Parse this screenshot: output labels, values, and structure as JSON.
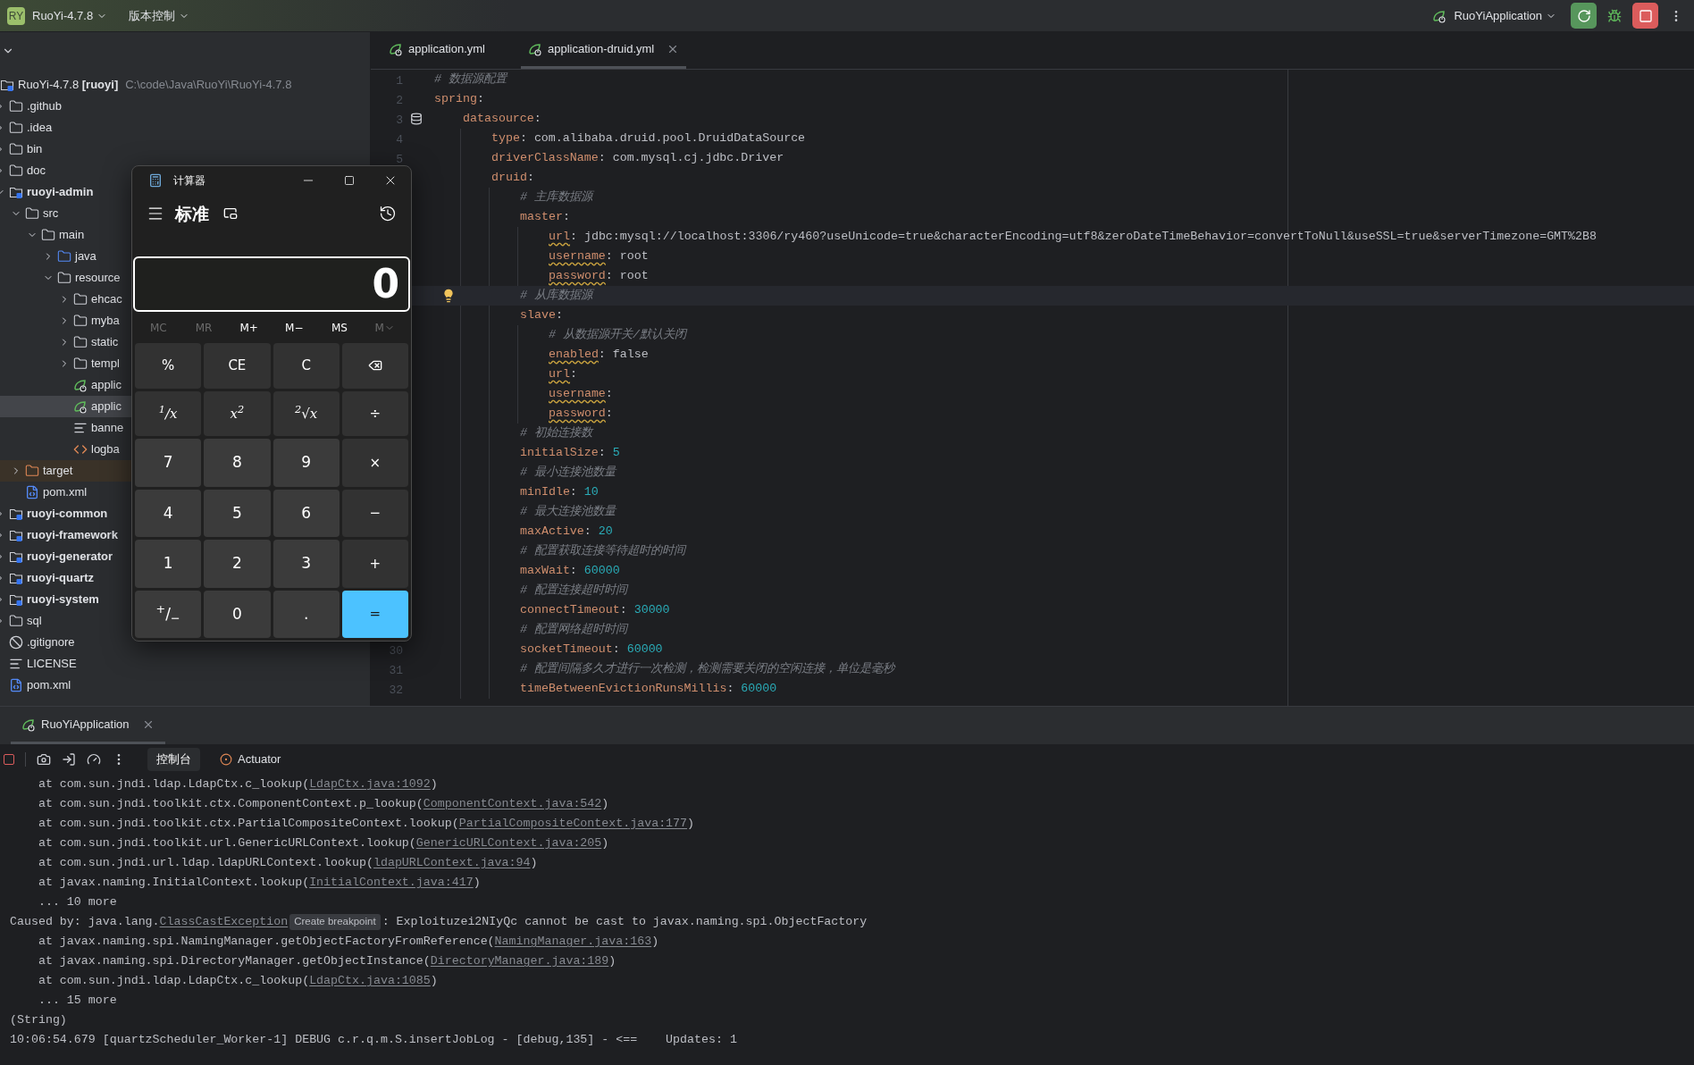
{
  "title_bar": {
    "logo": "RY",
    "project": "RuoYi-4.7.8",
    "vcs": "版本控制",
    "run_config": "RuoYiApplication"
  },
  "project": {
    "tree": [
      {
        "label": "RuoYi-4.7.8 **[ruoyi]**",
        "hint": "C:\\code\\Java\\RuoYi\\RuoYi-4.7.8",
        "kind": "module",
        "selected": false,
        "children": [
          {
            "label": ".github",
            "kind": "folder",
            "expanded": false,
            "selected": false
          },
          {
            "label": ".idea",
            "kind": "folder",
            "expanded": false,
            "selected": false
          },
          {
            "label": "bin",
            "kind": "folder",
            "expanded": false,
            "selected": false
          },
          {
            "label": "doc",
            "kind": "folder",
            "expanded": false,
            "selected": false
          },
          {
            "label": "ruoyi-admin",
            "kind": "module",
            "expanded": true,
            "selected": false,
            "children": [
              {
                "label": "src",
                "kind": "folder",
                "expanded": true,
                "selected": false,
                "children": [
                  {
                    "label": "main",
                    "kind": "folder",
                    "expanded": true,
                    "selected": false,
                    "children": [
                      {
                        "label": "java",
                        "kind": "source-folder",
                        "expanded": false,
                        "selected": false
                      },
                      {
                        "label": "resource",
                        "kind": "resource-folder",
                        "expanded": true,
                        "selected": false,
                        "children": [
                          {
                            "label": "ehcac",
                            "kind": "folder",
                            "expanded": false,
                            "selected": false
                          },
                          {
                            "label": "myba",
                            "kind": "folder",
                            "expanded": false,
                            "selected": false
                          },
                          {
                            "label": "static",
                            "kind": "folder",
                            "expanded": false,
                            "selected": false
                          },
                          {
                            "label": "templ",
                            "kind": "folder",
                            "expanded": false,
                            "selected": false
                          },
                          {
                            "label": "applic",
                            "kind": "yaml",
                            "selected": false
                          },
                          {
                            "label": "applic",
                            "kind": "yaml",
                            "selected": true
                          },
                          {
                            "label": "banne",
                            "kind": "text",
                            "selected": false
                          },
                          {
                            "label": "logba",
                            "kind": "xml",
                            "selected": false
                          }
                        ]
                      }
                    ]
                  }
                ]
              },
              {
                "label": "target",
                "kind": "excluded-folder",
                "expanded": false,
                "selected": false
              },
              {
                "label": "pom.xml",
                "kind": "maven",
                "selected": false
              }
            ]
          },
          {
            "label": "ruoyi-common",
            "kind": "module",
            "expanded": false,
            "selected": false
          },
          {
            "label": "ruoyi-framework",
            "kind": "module",
            "expanded": false,
            "selected": false
          },
          {
            "label": "ruoyi-generator",
            "kind": "module",
            "expanded": false,
            "selected": false
          },
          {
            "label": "ruoyi-quartz",
            "kind": "module",
            "expanded": false,
            "selected": false
          },
          {
            "label": "ruoyi-system",
            "kind": "module",
            "expanded": false,
            "selected": false
          },
          {
            "label": "sql",
            "kind": "folder",
            "expanded": false,
            "selected": false
          },
          {
            "label": ".gitignore",
            "kind": "ignore",
            "selected": false
          },
          {
            "label": "LICENSE",
            "kind": "text",
            "selected": false
          },
          {
            "label": "pom.xml",
            "kind": "maven",
            "selected": false
          }
        ]
      }
    ]
  },
  "editor": {
    "tabs": [
      {
        "label": "application.yml",
        "selected": false
      },
      {
        "label": "application-druid.yml",
        "selected": true
      }
    ],
    "lines": [
      {
        "number": "1",
        "kind": "comment",
        "text": "# 数据源配置",
        "caret": false
      },
      {
        "number": "2",
        "kind": "key",
        "key": "spring:",
        "warning": false,
        "caret": false,
        "children": [
          {
            "number": "3",
            "kind": "key",
            "key": "datasource:",
            "warning": false,
            "caret": false,
            "gutter_icon": true,
            "children": [
              {
                "number": "4",
                "kind": "key",
                "key": "type:",
                "value": "com.alibaba.druid.pool.DruidDataSource",
                "numeric": false,
                "warning": false,
                "caret": false
              },
              {
                "number": "5",
                "kind": "key",
                "key": "driverClassName:",
                "value": "com.mysql.cj.jdbc.Driver",
                "numeric": false,
                "warning": false,
                "caret": false
              },
              {
                "kind": "key",
                "key": "druid:",
                "warning": false,
                "caret": false,
                "children": [
                  {
                    "kind": "comment",
                    "text": "# 主库数据源",
                    "caret": false
                  },
                  {
                    "kind": "key",
                    "key": "master:",
                    "warning": false,
                    "caret": false,
                    "children": [
                      {
                        "kind": "key",
                        "key": "url:",
                        "value": "jdbc:mysql://localhost:3306/ry460?useUnicode=true&characterEncoding=utf8&zeroDateTimeBehavior=convertToNull&useSSL=true&serverTimezone=GMT%2B8",
                        "numeric": false,
                        "warning": true,
                        "caret": false
                      },
                      {
                        "kind": "key",
                        "key": "username:",
                        "value": "root",
                        "numeric": false,
                        "warning": true,
                        "caret": false
                      },
                      {
                        "kind": "key",
                        "key": "password:",
                        "value": "root",
                        "numeric": false,
                        "warning": true,
                        "caret": false
                      }
                    ]
                  },
                  {
                    "kind": "comment",
                    "text": "# 从库数据源",
                    "caret": true
                  },
                  {
                    "kind": "key",
                    "key": "slave:",
                    "warning": false,
                    "caret": false,
                    "children": [
                      {
                        "kind": "comment",
                        "text": "# 从数据源开关/默认关闭",
                        "caret": false
                      },
                      {
                        "kind": "key",
                        "key": "enabled:",
                        "value": "false",
                        "numeric": false,
                        "warning": true,
                        "caret": false
                      },
                      {
                        "kind": "key",
                        "key": "url:",
                        "warning": true,
                        "caret": false
                      },
                      {
                        "kind": "key",
                        "key": "username:",
                        "warning": true,
                        "caret": false
                      },
                      {
                        "kind": "key",
                        "key": "password:",
                        "warning": true,
                        "caret": false
                      }
                    ]
                  },
                  {
                    "kind": "comment",
                    "text": "# 初始连接数",
                    "caret": false
                  },
                  {
                    "kind": "key",
                    "key": "initialSize:",
                    "value": "5",
                    "numeric": true,
                    "warning": false,
                    "caret": false
                  },
                  {
                    "kind": "comment",
                    "text": "# 最小连接池数量",
                    "caret": false
                  },
                  {
                    "kind": "key",
                    "key": "minIdle:",
                    "value": "10",
                    "numeric": true,
                    "warning": false,
                    "caret": false
                  },
                  {
                    "kind": "comment",
                    "text": "# 最大连接池数量",
                    "caret": false
                  },
                  {
                    "kind": "key",
                    "key": "maxActive:",
                    "value": "20",
                    "numeric": true,
                    "warning": false,
                    "caret": false
                  },
                  {
                    "kind": "comment",
                    "text": "# 配置获取连接等待超时的时间",
                    "caret": false
                  },
                  {
                    "kind": "key",
                    "key": "maxWait:",
                    "value": "60000",
                    "numeric": true,
                    "warning": false,
                    "caret": false
                  },
                  {
                    "kind": "comment",
                    "text": "# 配置连接超时时间",
                    "caret": false
                  },
                  {
                    "kind": "key",
                    "key": "connectTimeout:",
                    "value": "30000",
                    "numeric": true,
                    "warning": false,
                    "caret": false
                  },
                  {
                    "kind": "comment",
                    "text": "# 配置网络超时时间",
                    "caret": false
                  },
                  {
                    "number": "30",
                    "kind": "key",
                    "key": "socketTimeout:",
                    "value": "60000",
                    "numeric": true,
                    "warning": false,
                    "caret": false
                  },
                  {
                    "number": "31",
                    "kind": "comment",
                    "text": "# 配置间隔多久才进行一次检测，检测需要关闭的空闲连接，单位是毫秒",
                    "caret": false
                  },
                  {
                    "number": "32",
                    "kind": "key",
                    "key": "timeBetweenEvictionRunsMillis:",
                    "value": "60000",
                    "numeric": true,
                    "warning": false,
                    "caret": false
                  }
                ]
              }
            ]
          }
        ]
      }
    ]
  },
  "calculator": {
    "title": "计算器",
    "mode": "标准",
    "display": "0",
    "memory": [
      {
        "label": "MC",
        "disabled": true,
        "kind": "plain"
      },
      {
        "label": "MR",
        "disabled": true,
        "kind": "plain"
      },
      {
        "label": "M+",
        "disabled": false,
        "kind": "plain"
      },
      {
        "label": "M−",
        "disabled": false,
        "kind": "plain"
      },
      {
        "label": "MS",
        "disabled": false,
        "kind": "plain"
      },
      {
        "label": "M",
        "disabled": true,
        "kind": "dropdown"
      }
    ],
    "keys": [
      {
        "label": "%",
        "kind": "function"
      },
      {
        "label": "CE",
        "kind": "function"
      },
      {
        "label": "C",
        "kind": "function"
      },
      {
        "kind": "backspace"
      },
      {
        "label": "$^{1}$/x",
        "kind": "function"
      },
      {
        "label": "x$^{2}$",
        "kind": "function"
      },
      {
        "label": "$^{2}$√x",
        "kind": "function"
      },
      {
        "label": "÷",
        "kind": "function"
      },
      {
        "label": "7",
        "kind": "digit"
      },
      {
        "label": "8",
        "kind": "digit"
      },
      {
        "label": "9",
        "kind": "digit"
      },
      {
        "label": "×",
        "kind": "function"
      },
      {
        "label": "4",
        "kind": "digit"
      },
      {
        "label": "5",
        "kind": "digit"
      },
      {
        "label": "6",
        "kind": "digit"
      },
      {
        "label": "−",
        "kind": "function"
      },
      {
        "label": "1",
        "kind": "digit"
      },
      {
        "label": "2",
        "kind": "digit"
      },
      {
        "label": "3",
        "kind": "digit"
      },
      {
        "label": "+",
        "kind": "function"
      },
      {
        "label": "$^{+}$/$_{−}$",
        "kind": "digit"
      },
      {
        "label": "0",
        "kind": "digit"
      },
      {
        "label": ".",
        "kind": "digit"
      },
      {
        "label": "=",
        "kind": "equals"
      }
    ]
  },
  "run_panel": {
    "tabs": [
      {
        "label": "RuoYiApplication",
        "selected": true
      }
    ],
    "console_tabs": [
      {
        "label": "控制台",
        "selected": true,
        "kind": "plain"
      },
      {
        "label": "Actuator",
        "selected": false,
        "kind": "actuator"
      }
    ],
    "console": [
      [
        {
          "kind": "text",
          "text": "    at com.sun.jndi.ldap.LdapCtx.c_lookup("
        },
        {
          "kind": "link",
          "text": "LdapCtx.java:1092"
        },
        {
          "kind": "text",
          "text": ")"
        }
      ],
      [
        {
          "kind": "text",
          "text": "    at com.sun.jndi.toolkit.ctx.ComponentContext.p_lookup("
        },
        {
          "kind": "link",
          "text": "ComponentContext.java:542"
        },
        {
          "kind": "text",
          "text": ")"
        }
      ],
      [
        {
          "kind": "text",
          "text": "    at com.sun.jndi.toolkit.ctx.PartialCompositeContext.lookup("
        },
        {
          "kind": "link",
          "text": "PartialCompositeContext.java:177"
        },
        {
          "kind": "text",
          "text": ")"
        }
      ],
      [
        {
          "kind": "text",
          "text": "    at com.sun.jndi.toolkit.url.GenericURLContext.lookup("
        },
        {
          "kind": "link",
          "text": "GenericURLContext.java:205"
        },
        {
          "kind": "text",
          "text": ")"
        }
      ],
      [
        {
          "kind": "text",
          "text": "    at com.sun.jndi.url.ldap.ldapURLContext.lookup("
        },
        {
          "kind": "link",
          "text": "ldapURLContext.java:94"
        },
        {
          "kind": "text",
          "text": ")"
        }
      ],
      [
        {
          "kind": "text",
          "text": "    at javax.naming.InitialContext.lookup("
        },
        {
          "kind": "link",
          "text": "InitialContext.java:417"
        },
        {
          "kind": "text",
          "text": ")"
        }
      ],
      [
        {
          "kind": "text",
          "text": "    ... 10 more"
        }
      ],
      [
        {
          "kind": "text",
          "text": "Caused by: java.lang."
        },
        {
          "kind": "link",
          "text": "ClassCastException"
        },
        {
          "kind": "badge",
          "text": "Create breakpoint"
        },
        {
          "kind": "text",
          "text": ": Exploituzei2NIyQc cannot be cast to javax.naming.spi.ObjectFactory"
        }
      ],
      [
        {
          "kind": "text",
          "text": "    at javax.naming.spi.NamingManager.getObjectFactoryFromReference("
        },
        {
          "kind": "link",
          "text": "NamingManager.java:163"
        },
        {
          "kind": "text",
          "text": ")"
        }
      ],
      [
        {
          "kind": "text",
          "text": "    at javax.naming.spi.DirectoryManager.getObjectInstance("
        },
        {
          "kind": "link",
          "text": "DirectoryManager.java:189"
        },
        {
          "kind": "text",
          "text": ")"
        }
      ],
      [
        {
          "kind": "text",
          "text": "    at com.sun.jndi.ldap.LdapCtx.c_lookup("
        },
        {
          "kind": "link",
          "text": "LdapCtx.java:1085"
        },
        {
          "kind": "text",
          "text": ")"
        }
      ],
      [
        {
          "kind": "text",
          "text": "    ... 15 more"
        }
      ],
      [
        {
          "kind": "text",
          "text": "(String)"
        }
      ],
      [
        {
          "kind": "text",
          "text": "10:06:54.679 [quartzScheduler_Worker-1] DEBUG c.r.q.m.S.insertJobLog - [debug,135] - <==    Updates: 1"
        }
      ]
    ]
  }
}
